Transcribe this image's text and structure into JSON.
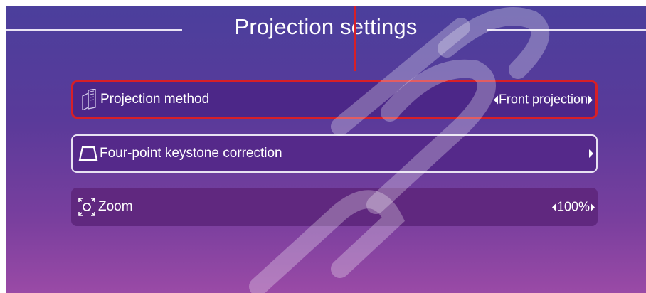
{
  "header": {
    "title": "Projection settings"
  },
  "settings": {
    "items": [
      {
        "label": "Projection method",
        "value": "Front projection",
        "icon": "projection-method-icon"
      },
      {
        "label": "Four-point keystone correction",
        "value": "",
        "icon": "keystone-trapezoid-icon"
      },
      {
        "label": "Zoom",
        "value": "100%",
        "icon": "zoom-icon"
      }
    ]
  },
  "colors": {
    "highlight": "#d81f26",
    "background_top": "#4b3f9c",
    "background_bottom": "#9a4aa6"
  }
}
